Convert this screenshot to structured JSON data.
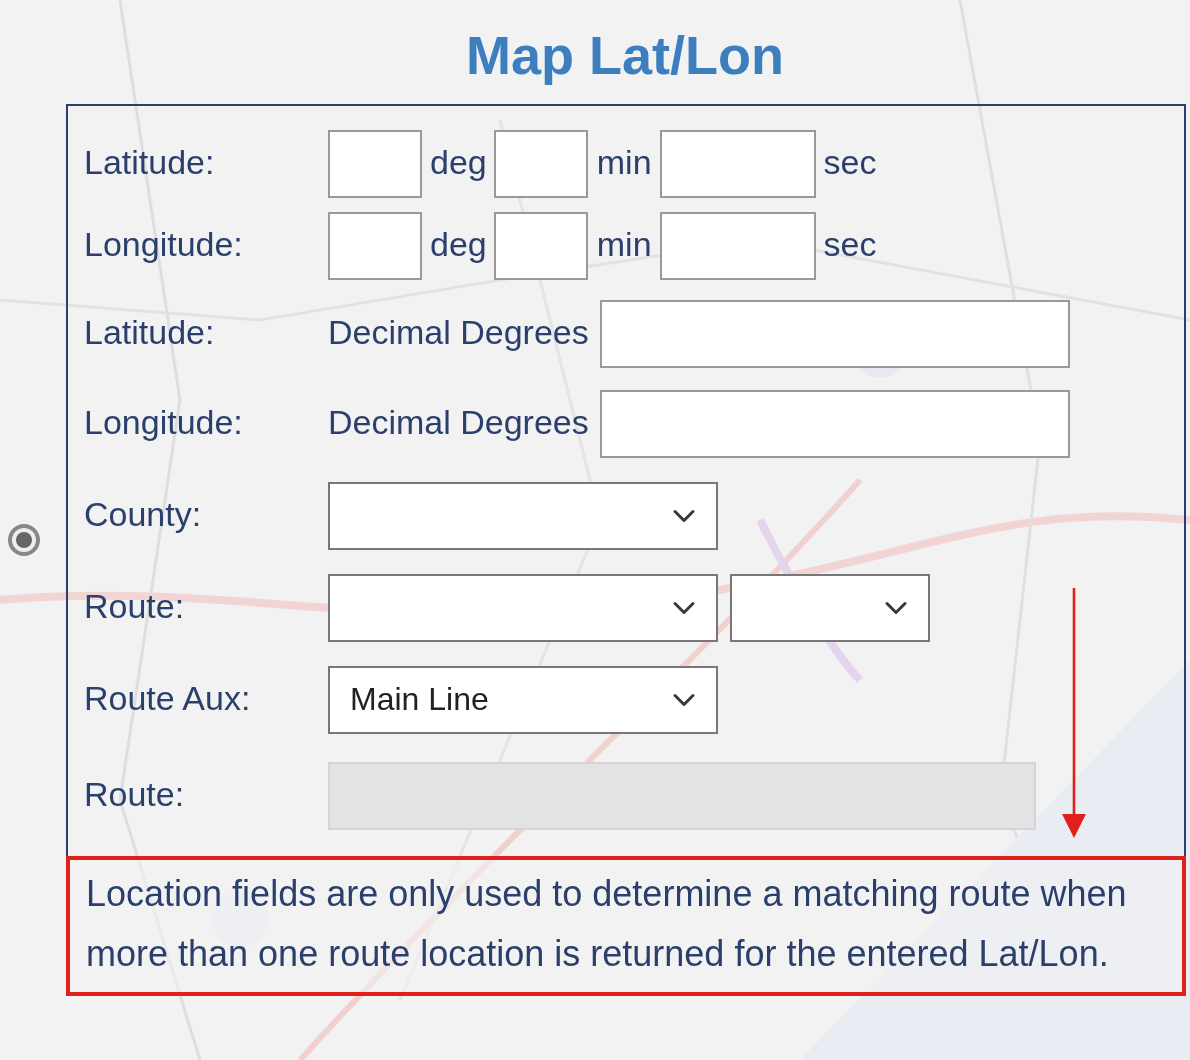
{
  "title": "Map Lat/Lon",
  "location_option": {
    "selected": true
  },
  "dms_rows": [
    {
      "label": "Latitude:",
      "units": [
        "deg",
        "min",
        "sec"
      ]
    },
    {
      "label": "Longitude:",
      "units": [
        "deg",
        "min",
        "sec"
      ]
    }
  ],
  "decimal_rows": [
    {
      "label": "Latitude:",
      "hint": "Decimal Degrees"
    },
    {
      "label": "Longitude:",
      "hint": "Decimal Degrees"
    }
  ],
  "county": {
    "label": "County:"
  },
  "route": {
    "label": "Route:"
  },
  "route_aux": {
    "label": "Route Aux:",
    "value": "Main Line"
  },
  "route_result": {
    "label": "Route:",
    "disabled": true
  },
  "note": "Location fields are only used to determine a matching route when more than one route location is returned for the entered Lat/Lon."
}
